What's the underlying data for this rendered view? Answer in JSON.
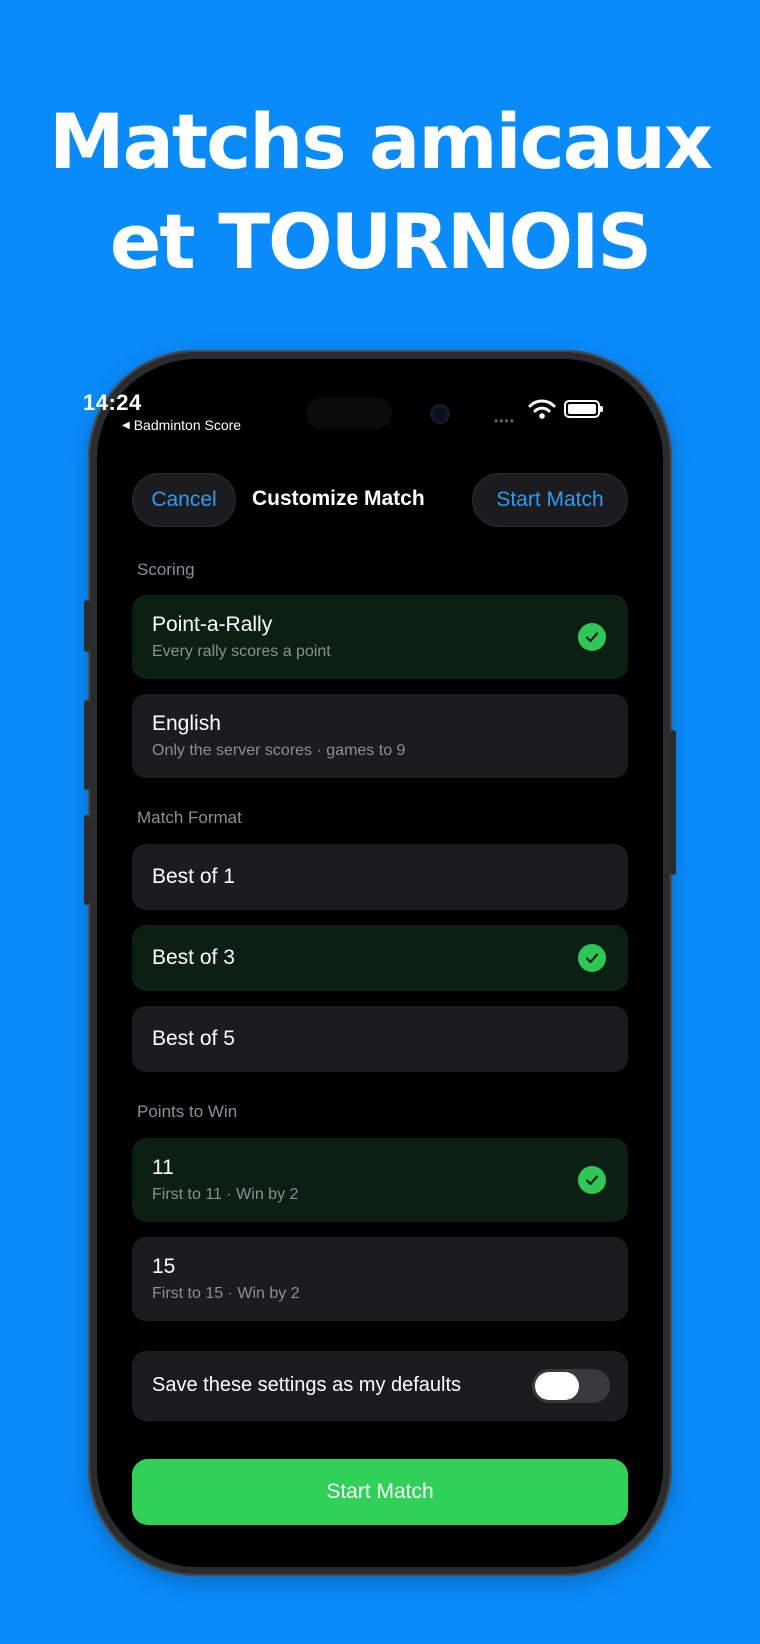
{
  "headline": {
    "line1": "Matchs amicaux",
    "line2": "et TOURNOIS"
  },
  "status": {
    "time": "14:24",
    "back_label": "Badminton Score",
    "signal": "••••"
  },
  "nav": {
    "cancel": "Cancel",
    "title": "Customize Match",
    "start": "Start Match"
  },
  "scoring": {
    "label": "Scoring",
    "options": [
      {
        "title": "Point-a-Rally",
        "subtitle": "Every rally scores a point",
        "selected": true
      },
      {
        "title": "English",
        "subtitle": "Only the server scores · games to 9",
        "selected": false
      }
    ]
  },
  "format": {
    "label": "Match Format",
    "options": [
      {
        "title": "Best of 1",
        "selected": false
      },
      {
        "title": "Best of 3",
        "selected": true
      },
      {
        "title": "Best of 5",
        "selected": false
      }
    ]
  },
  "points": {
    "label": "Points to Win",
    "options": [
      {
        "title": "11",
        "subtitle": "First to 11 · Win by 2",
        "selected": true
      },
      {
        "title": "15",
        "subtitle": "First to 15 · Win by 2",
        "selected": false
      }
    ]
  },
  "defaults": {
    "label": "Save these settings as my defaults",
    "enabled": false
  },
  "start_button": "Start Match",
  "colors": {
    "background": "#0a8bfb",
    "accent": "#2c9cf5",
    "green": "#2fd158",
    "selected_card": "#0b1f13"
  }
}
